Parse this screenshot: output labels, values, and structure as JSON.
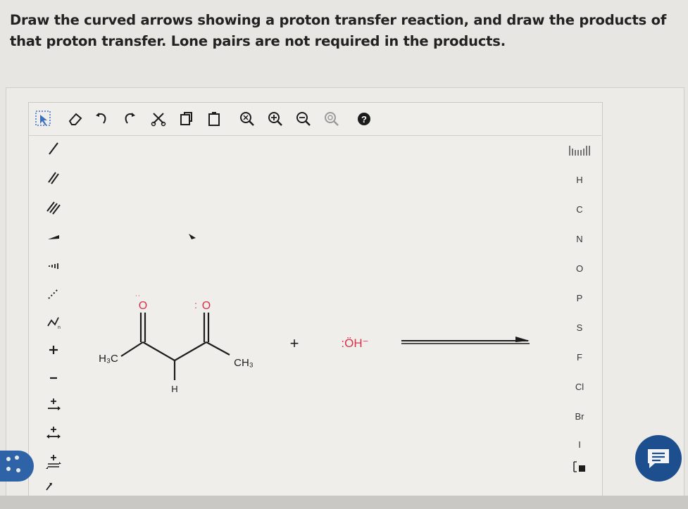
{
  "question": {
    "text": "Draw the curved arrows showing a proton transfer reaction, and draw the products of that proton transfer. Lone pairs are not required in the products."
  },
  "toolbar": {
    "icons": [
      "select-icon",
      "eraser-icon",
      "undo-icon",
      "redo-icon",
      "cut-icon",
      "copy-icon",
      "paste-icon",
      "zoom-fit-icon",
      "zoom-in-icon",
      "zoom-out-icon",
      "zoom-reset-icon",
      "help-icon"
    ]
  },
  "left_tools": {
    "icons": [
      "single-bond-icon",
      "double-bond-icon",
      "triple-bond-icon",
      "wedge-bond-icon",
      "hash-bond-icon",
      "dashed-bond-icon",
      "chain-icon",
      "plus-charge-icon",
      "minus-charge-icon",
      "single-arrow-icon",
      "resonance-arrow-icon",
      "equilibrium-arrow-icon"
    ]
  },
  "elements": {
    "periodic_label": "Periodic table",
    "items": [
      "H",
      "C",
      "N",
      "O",
      "P",
      "S",
      "F",
      "Cl",
      "Br",
      "I"
    ]
  },
  "reaction": {
    "o1_label": "O",
    "o2_label": "O",
    "h3c_label": "H₃C",
    "ch3_label": "CH₃",
    "h_label": "H",
    "plus_sign": "+",
    "hydroxide_label": ":ÖH⁻",
    "colors": {
      "oxygen": "#d9304a",
      "bond": "#1c1c1c"
    }
  }
}
